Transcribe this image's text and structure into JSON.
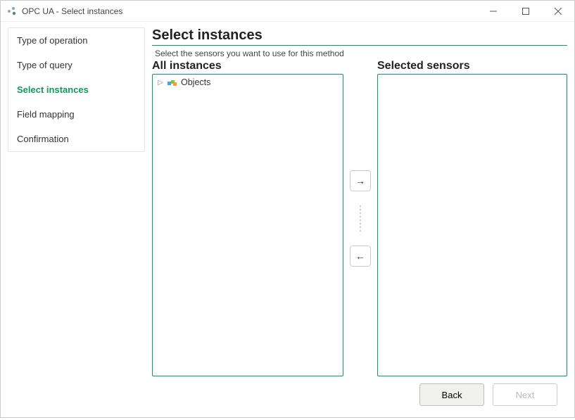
{
  "window": {
    "title": "OPC UA - Select instances"
  },
  "sidebar": {
    "items": [
      {
        "label": "Type of operation",
        "active": false
      },
      {
        "label": "Type of query",
        "active": false
      },
      {
        "label": "Select instances",
        "active": true
      },
      {
        "label": "Field mapping",
        "active": false
      },
      {
        "label": "Confirmation",
        "active": false
      }
    ]
  },
  "main": {
    "title": "Select instances",
    "subtitle": "Select the sensors you want to use for this method",
    "all_label": "All instances",
    "selected_label": "Selected sensors",
    "tree": {
      "root_label": "Objects"
    },
    "transfer": {
      "add": "→",
      "remove": "←"
    }
  },
  "footer": {
    "back": "Back",
    "next": "Next"
  }
}
